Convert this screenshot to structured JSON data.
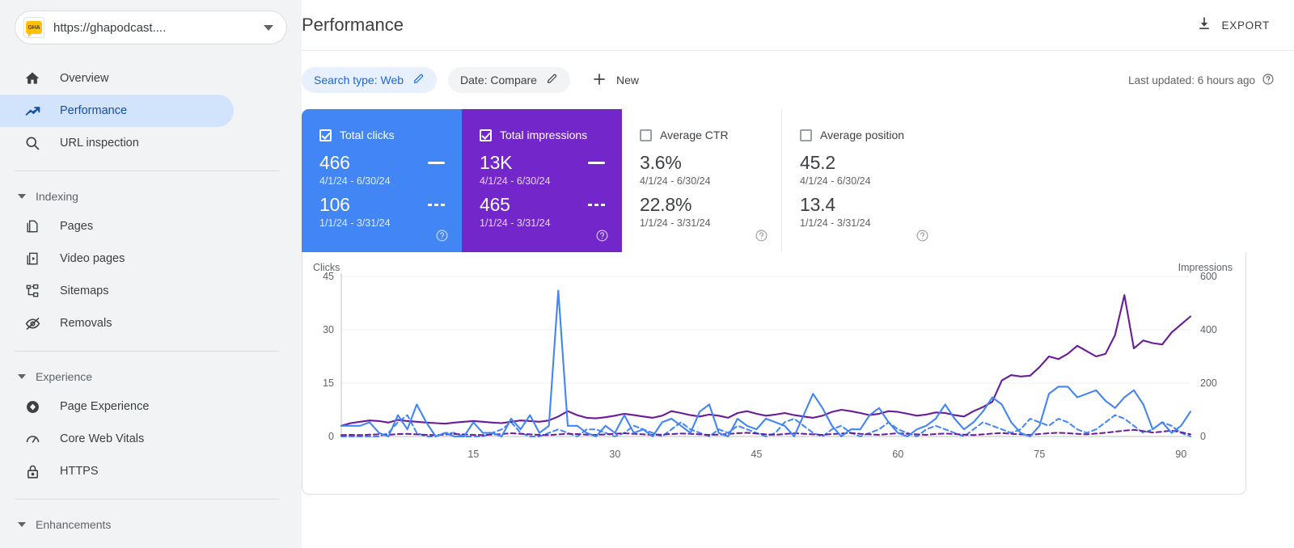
{
  "sidebar": {
    "property": {
      "logo_text": "GHA",
      "url": "https://ghapodcast....",
      "dropdown_icon": "chevron-down-icon"
    },
    "main_items": [
      {
        "label": "Overview",
        "icon": "home-icon",
        "active": false
      },
      {
        "label": "Performance",
        "icon": "trending-up-icon",
        "active": true
      },
      {
        "label": "URL inspection",
        "icon": "search-icon",
        "active": false
      }
    ],
    "groups": [
      {
        "label": "Indexing",
        "items": [
          {
            "label": "Pages",
            "icon": "pages-icon"
          },
          {
            "label": "Video pages",
            "icon": "video-pages-icon"
          },
          {
            "label": "Sitemaps",
            "icon": "sitemap-icon"
          },
          {
            "label": "Removals",
            "icon": "eye-off-icon"
          }
        ]
      },
      {
        "label": "Experience",
        "items": [
          {
            "label": "Page Experience",
            "icon": "page-experience-icon"
          },
          {
            "label": "Core Web Vitals",
            "icon": "speedometer-icon"
          },
          {
            "label": "HTTPS",
            "icon": "lock-icon"
          }
        ]
      },
      {
        "label": "Enhancements",
        "items": []
      }
    ]
  },
  "header": {
    "title": "Performance",
    "export_label": "EXPORT",
    "export_icon": "download-icon"
  },
  "filters": {
    "chips": [
      {
        "label": "Search type: Web",
        "icon": "pencil-icon",
        "style": "blue"
      },
      {
        "label": "Date: Compare",
        "icon": "pencil-icon",
        "style": "grey"
      }
    ],
    "new_label": "New",
    "new_icon": "plus-icon",
    "last_updated": "Last updated: 6 hours ago",
    "last_updated_icon": "help-circle-icon"
  },
  "metric_cards": [
    {
      "title": "Total clicks",
      "checked": true,
      "style": "sel-blue",
      "current_value": "466",
      "current_range": "4/1/24 - 6/30/24",
      "previous_value": "106",
      "previous_range": "1/1/24 - 3/31/24",
      "help_icon": "help-circle-icon"
    },
    {
      "title": "Total impressions",
      "checked": true,
      "style": "sel-purple",
      "current_value": "13K",
      "current_range": "4/1/24 - 6/30/24",
      "previous_value": "465",
      "previous_range": "1/1/24 - 3/31/24",
      "help_icon": "help-circle-icon"
    },
    {
      "title": "Average CTR",
      "checked": false,
      "style": "",
      "current_value": "3.6%",
      "current_range": "4/1/24 - 6/30/24",
      "previous_value": "22.8%",
      "previous_range": "1/1/24 - 3/31/24",
      "help_icon": "help-circle-icon"
    },
    {
      "title": "Average position",
      "checked": false,
      "style": "",
      "current_value": "45.2",
      "current_range": "4/1/24 - 6/30/24",
      "previous_value": "13.4",
      "previous_range": "1/1/24 - 3/31/24",
      "help_icon": "help-circle-icon"
    }
  ],
  "colors": {
    "clicks_blue": "#4285f4",
    "impressions_purple": "#7326c9",
    "chip_blue_bg": "#e8f0fe",
    "chip_blue_text": "#1967d2",
    "nav_active_bg": "#d2e3fc",
    "sidebar_bg": "#f1f3f4"
  },
  "chart_data": {
    "type": "line",
    "title": "",
    "ylabel": "Clicks",
    "y2label": "Impressions",
    "xlabel": "",
    "ylim": [
      0,
      45
    ],
    "y2lim": [
      0,
      600
    ],
    "yticks": [
      0,
      15,
      30,
      45
    ],
    "y2ticks": [
      0,
      200,
      400,
      600
    ],
    "xticks": [
      15,
      30,
      45,
      60,
      75,
      90
    ],
    "xlim": [
      1,
      91
    ],
    "grid": true,
    "legend": "none",
    "x": [
      1,
      2,
      3,
      4,
      5,
      6,
      7,
      8,
      9,
      10,
      11,
      12,
      13,
      14,
      15,
      16,
      17,
      18,
      19,
      20,
      21,
      22,
      23,
      24,
      25,
      26,
      27,
      28,
      29,
      30,
      31,
      32,
      33,
      34,
      35,
      36,
      37,
      38,
      39,
      40,
      41,
      42,
      43,
      44,
      45,
      46,
      47,
      48,
      49,
      50,
      51,
      52,
      53,
      54,
      55,
      56,
      57,
      58,
      59,
      60,
      61,
      62,
      63,
      64,
      65,
      66,
      67,
      68,
      69,
      70,
      71,
      72,
      73,
      74,
      75,
      76,
      77,
      78,
      79,
      80,
      81,
      82,
      83,
      84,
      85,
      86,
      87,
      88,
      89,
      90,
      91
    ],
    "series": [
      {
        "name": "Total clicks",
        "axis": "left",
        "color": "#4285f4",
        "style": "solid",
        "period": "4/1/24 - 6/30/24",
        "values": [
          3,
          3,
          3,
          4,
          1,
          0,
          6,
          2,
          9,
          4,
          0,
          1,
          0,
          0,
          4,
          1,
          1,
          0,
          5,
          2,
          6,
          1,
          3,
          41,
          3,
          3,
          1,
          0,
          3,
          1,
          6,
          1,
          2,
          0,
          4,
          5,
          3,
          1,
          7,
          9,
          1,
          0,
          5,
          3,
          2,
          5,
          4,
          3,
          0,
          6,
          12,
          8,
          3,
          0,
          2,
          2,
          6,
          8,
          4,
          1,
          0,
          2,
          3,
          5,
          9,
          5,
          2,
          4,
          7,
          11,
          9,
          4,
          1,
          0,
          3,
          12,
          14,
          14,
          11,
          12,
          13,
          10,
          8,
          11,
          13,
          9,
          2,
          4,
          1,
          3,
          7
        ]
      },
      {
        "name": "Total clicks (previous)",
        "axis": "left",
        "color": "#4285f4",
        "style": "dashed",
        "period": "1/1/24 - 3/31/24",
        "values": [
          0,
          0,
          0,
          0,
          0,
          1,
          4,
          6,
          1,
          0,
          0,
          1,
          1,
          0,
          0,
          0,
          1,
          2,
          4,
          1,
          0,
          0,
          1,
          2,
          1,
          0,
          2,
          2,
          1,
          0,
          1,
          3,
          2,
          1,
          0,
          2,
          4,
          2,
          1,
          0,
          2,
          1,
          3,
          2,
          1,
          0,
          1,
          4,
          5,
          3,
          1,
          0,
          2,
          3,
          1,
          0,
          1,
          2,
          4,
          2,
          1,
          0,
          2,
          3,
          2,
          1,
          0,
          2,
          4,
          3,
          2,
          1,
          2,
          5,
          4,
          3,
          5,
          4,
          2,
          1,
          2,
          4,
          6,
          5,
          3,
          1,
          2,
          4,
          3,
          1,
          0
        ]
      },
      {
        "name": "Total impressions",
        "axis": "right",
        "color": "#6a1b9a",
        "style": "solid",
        "period": "4/1/24 - 6/30/24",
        "values": [
          40,
          50,
          55,
          60,
          58,
          52,
          62,
          58,
          55,
          52,
          50,
          48,
          52,
          55,
          58,
          55,
          52,
          50,
          55,
          60,
          58,
          55,
          60,
          75,
          95,
          80,
          70,
          68,
          72,
          78,
          85,
          80,
          75,
          70,
          78,
          95,
          88,
          80,
          75,
          82,
          78,
          70,
          88,
          95,
          85,
          78,
          82,
          88,
          80,
          75,
          70,
          78,
          92,
          100,
          95,
          88,
          80,
          85,
          95,
          92,
          85,
          78,
          82,
          90,
          88,
          80,
          75,
          95,
          110,
          130,
          210,
          230,
          225,
          228,
          260,
          300,
          290,
          310,
          340,
          320,
          300,
          310,
          380,
          530,
          330,
          360,
          350,
          345,
          390,
          420,
          450
        ]
      },
      {
        "name": "Total impressions (previous)",
        "axis": "right",
        "color": "#6a1b9a",
        "style": "dashed",
        "period": "1/1/24 - 3/31/24",
        "values": [
          5,
          6,
          5,
          7,
          8,
          6,
          9,
          10,
          8,
          6,
          5,
          7,
          9,
          8,
          6,
          5,
          7,
          9,
          12,
          10,
          8,
          6,
          5,
          8,
          10,
          9,
          7,
          6,
          8,
          10,
          12,
          10,
          8,
          6,
          7,
          9,
          11,
          10,
          8,
          6,
          7,
          9,
          12,
          14,
          11,
          8,
          6,
          9,
          12,
          10,
          8,
          6,
          9,
          11,
          13,
          10,
          8,
          6,
          9,
          12,
          10,
          8,
          6,
          9,
          11,
          9,
          7,
          5,
          8,
          11,
          13,
          10,
          8,
          6,
          9,
          12,
          14,
          12,
          10,
          8,
          11,
          14,
          18,
          22,
          25,
          20,
          15,
          18,
          22,
          16,
          8
        ]
      }
    ]
  }
}
